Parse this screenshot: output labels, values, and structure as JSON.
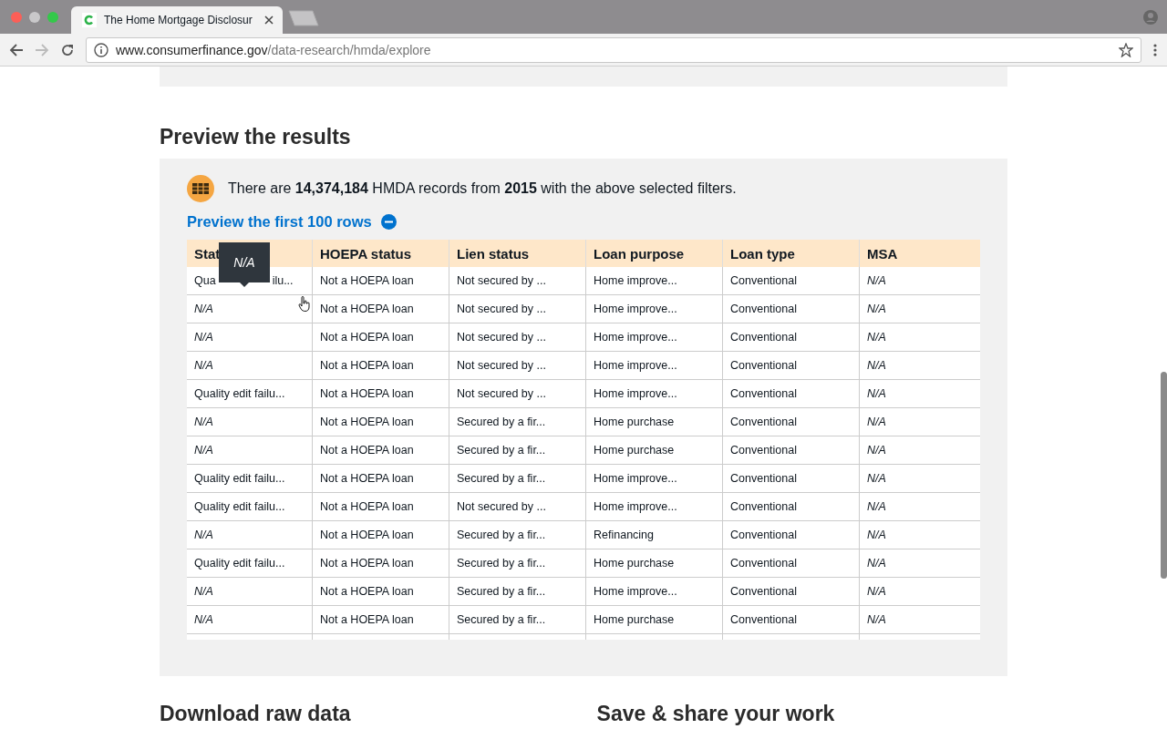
{
  "browser": {
    "tab_title": "The Home Mortgage Disclosur",
    "url_domain": "www.consumerfinance.gov",
    "url_path": "/data-research/hmda/explore"
  },
  "section_title": "Preview the results",
  "summary": "There are **14,374,184** HMDA records from **2015** with the above selected filters.",
  "preview_toggle": {
    "label": "Preview the first 100 rows",
    "expanded": true
  },
  "tooltip": "N/A",
  "table": {
    "columns": [
      "Stat",
      "HOEPA status",
      "Lien status",
      "Loan purpose",
      "Loan type",
      "MSA"
    ],
    "first_cell_parts": [
      "Qua",
      "ilu..."
    ],
    "rows": [
      [
        "",
        "Not a HOEPA loan",
        "Not secured by ...",
        "Home improve...",
        "Conventional",
        "N/A"
      ],
      [
        "N/A",
        "Not a HOEPA loan",
        "Not secured by ...",
        "Home improve...",
        "Conventional",
        "N/A"
      ],
      [
        "N/A",
        "Not a HOEPA loan",
        "Not secured by ...",
        "Home improve...",
        "Conventional",
        "N/A"
      ],
      [
        "N/A",
        "Not a HOEPA loan",
        "Not secured by ...",
        "Home improve...",
        "Conventional",
        "N/A"
      ],
      [
        "Quality edit failu...",
        "Not a HOEPA loan",
        "Not secured by ...",
        "Home improve...",
        "Conventional",
        "N/A"
      ],
      [
        "N/A",
        "Not a HOEPA loan",
        "Secured by a fir...",
        "Home purchase",
        "Conventional",
        "N/A"
      ],
      [
        "N/A",
        "Not a HOEPA loan",
        "Secured by a fir...",
        "Home purchase",
        "Conventional",
        "N/A"
      ],
      [
        "Quality edit failu...",
        "Not a HOEPA loan",
        "Secured by a fir...",
        "Home improve...",
        "Conventional",
        "N/A"
      ],
      [
        "Quality edit failu...",
        "Not a HOEPA loan",
        "Not secured by ...",
        "Home improve...",
        "Conventional",
        "N/A"
      ],
      [
        "N/A",
        "Not a HOEPA loan",
        "Secured by a fir...",
        "Refinancing",
        "Conventional",
        "N/A"
      ],
      [
        "Quality edit failu...",
        "Not a HOEPA loan",
        "Secured by a fir...",
        "Home purchase",
        "Conventional",
        "N/A"
      ],
      [
        "N/A",
        "Not a HOEPA loan",
        "Secured by a fir...",
        "Home improve...",
        "Conventional",
        "N/A"
      ],
      [
        "N/A",
        "Not a HOEPA loan",
        "Secured by a fir...",
        "Home purchase",
        "Conventional",
        "N/A"
      ]
    ]
  },
  "next_sections": [
    "Download raw data",
    "Save & share your work"
  ]
}
